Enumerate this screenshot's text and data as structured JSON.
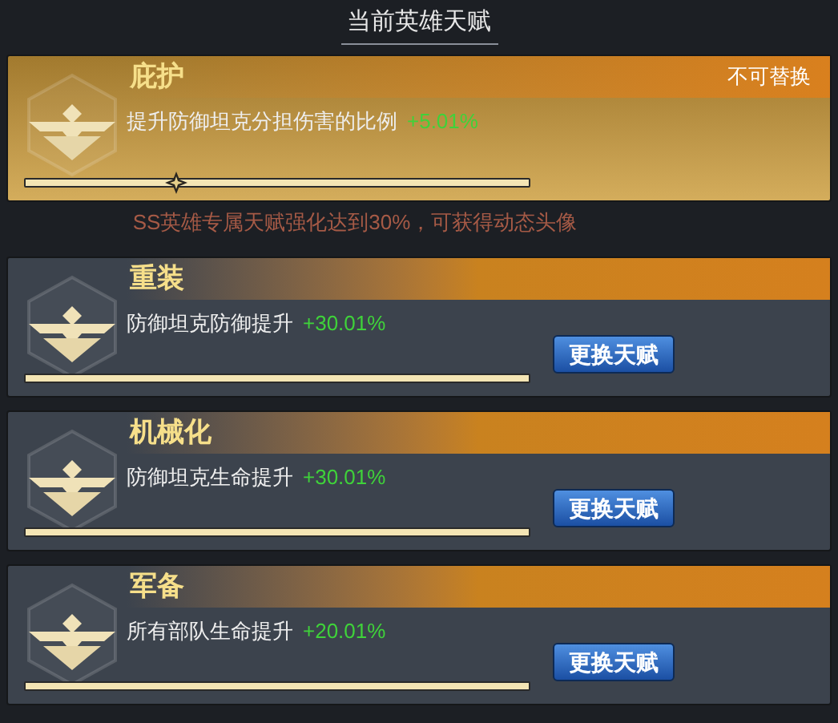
{
  "title": "当前英雄天赋",
  "talents": [
    {
      "kind": "fixed",
      "name": "庇护",
      "tag": "不可替换",
      "description": "提升防御坦克分担伤害的比例",
      "bonus": "+5.01%",
      "level": 0.3
    },
    {
      "kind": "replaceable",
      "name": "重装",
      "description": "防御坦克防御提升",
      "bonus": "+30.01%",
      "button": "更换天赋"
    },
    {
      "kind": "replaceable",
      "name": "机械化",
      "description": "防御坦克生命提升",
      "bonus": "+30.01%",
      "button": "更换天赋"
    },
    {
      "kind": "replaceable",
      "name": "军备",
      "description": "所有部队生命提升",
      "bonus": "+20.01%",
      "button": "更换天赋"
    }
  ],
  "note": "SS英雄专属天赋强化达到30%，可获得动态头像"
}
